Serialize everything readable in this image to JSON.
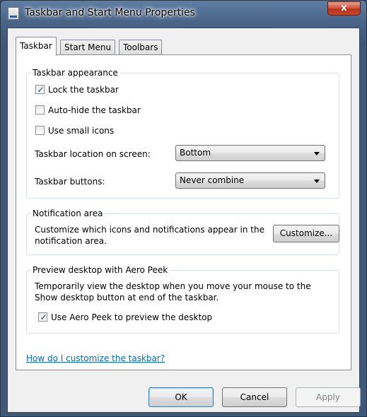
{
  "window": {
    "title": "Taskbar and Start Menu Properties",
    "close_glyph": "x"
  },
  "tabs": [
    {
      "label": "Taskbar",
      "active": true
    },
    {
      "label": "Start Menu",
      "active": false
    },
    {
      "label": "Toolbars",
      "active": false
    }
  ],
  "appearance": {
    "legend": "Taskbar appearance",
    "lock": {
      "label": "Lock the taskbar",
      "checked": true
    },
    "autohide": {
      "label": "Auto-hide the taskbar",
      "checked": false
    },
    "small_icons": {
      "label": "Use small icons",
      "checked": false
    },
    "location": {
      "label": "Taskbar location on screen:",
      "value": "Bottom"
    },
    "buttons": {
      "label": "Taskbar buttons:",
      "value": "Never combine"
    }
  },
  "notification": {
    "legend": "Notification area",
    "text_line1": "Customize which icons and notifications appear in the",
    "text_line2": "notification area.",
    "customize_label": "Customize..."
  },
  "aero_peek": {
    "legend": "Preview desktop with Aero Peek",
    "text_line1": "Temporarily view the desktop when you move your mouse to the",
    "text_line2": "Show desktop button at end of the taskbar.",
    "use_peek": {
      "label": "Use Aero Peek to preview the desktop",
      "checked": true
    }
  },
  "help_link": "How do I customize the taskbar?",
  "footer": {
    "ok": "OK",
    "cancel": "Cancel",
    "apply": "Apply"
  },
  "colors": {
    "accent": "#3c7fb1",
    "link": "#0066cc",
    "frame": "#4a6488"
  }
}
